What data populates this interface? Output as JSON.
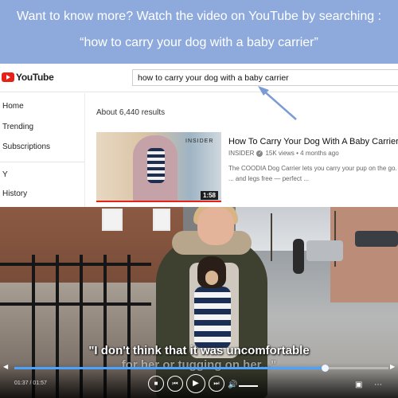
{
  "banner": {
    "line1": "Want to know more? Watch the video on YouTube by searching :",
    "line2": "“how to carry your dog with a baby carrier”"
  },
  "youtube": {
    "logo_text": "YouTube",
    "search_value": "how to carry your dog with a baby carrier",
    "sidebar": [
      "Home",
      "Trending",
      "Subscriptions",
      "Y",
      "History"
    ],
    "results_count": "About 6,440 results",
    "video": {
      "title": "How To Carry Your Dog With A Baby Carrier",
      "channel": "INSIDER",
      "verified_icon": "check-icon",
      "meta": "15K views • 4 months ago",
      "description": "The COODIA Dog Carrier lets you carry your pup on the go. ... and legs free — perfect ...",
      "thumb_brand": "INSIDER",
      "duration": "1:58"
    }
  },
  "player": {
    "subtitle_line1": "\"I don't think that it was uncomfortable",
    "subtitle_line2": "for her or tugging on her...\"",
    "time": "01:37 / 01:57",
    "progress_fraction": 0.83,
    "accent_color": "#4aa3ff",
    "icons": [
      "stop-icon",
      "previous-icon",
      "play-icon",
      "next-icon",
      "volume-icon",
      "fullscreen-icon",
      "settings-icon"
    ]
  }
}
